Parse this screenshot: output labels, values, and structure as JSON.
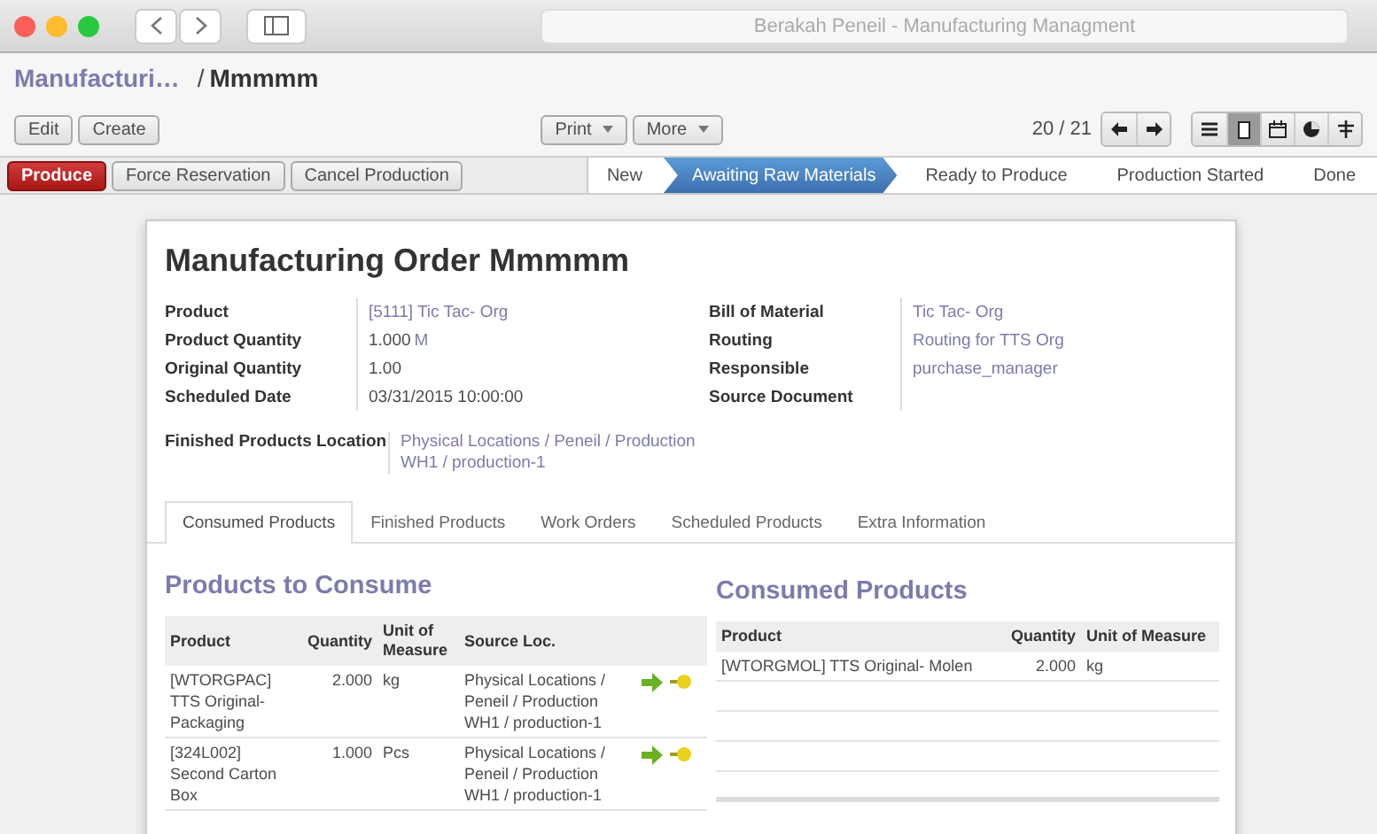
{
  "window": {
    "title": "Berakah Peneil - Manufacturing Managment"
  },
  "breadcrumb": {
    "parent": "Manufacturi…",
    "separator": "/",
    "current": "Mmmmm"
  },
  "toolbar": {
    "left_buttons": [
      "Edit",
      "Create"
    ],
    "menus": [
      "Print",
      "More"
    ],
    "pager": "20 / 21",
    "views": [
      {
        "kind": "list",
        "selected": false
      },
      {
        "kind": "form",
        "selected": true
      },
      {
        "kind": "calendar",
        "selected": false
      },
      {
        "kind": "graph",
        "selected": false
      },
      {
        "kind": "gantt",
        "selected": false
      }
    ]
  },
  "actions": [
    {
      "label": "Produce",
      "kind": "primary"
    },
    {
      "label": "Force Reservation",
      "kind": "default"
    },
    {
      "label": "Cancel Production",
      "kind": "default"
    }
  ],
  "stages": [
    {
      "label": "New",
      "selected": false
    },
    {
      "label": "Awaiting Raw Materials",
      "selected": true
    },
    {
      "label": "Ready to Produce",
      "selected": false
    },
    {
      "label": "Production Started",
      "selected": false
    },
    {
      "label": "Done",
      "selected": false
    }
  ],
  "form": {
    "title": "Manufacturing Order Mmmmm",
    "left_fields": [
      {
        "label": "Product",
        "value": "[5111] Tic Tac- Org",
        "kind": "link"
      },
      {
        "label": "Product Quantity",
        "value": "1.000",
        "unit": "M",
        "kind": "quantity"
      },
      {
        "label": "Original Quantity",
        "value": "1.00",
        "kind": "text"
      },
      {
        "label": "Scheduled Date",
        "value": "03/31/2015 10:00:00",
        "kind": "text"
      }
    ],
    "right_fields": [
      {
        "label": "Bill of Material",
        "value": "Tic Tac- Org",
        "kind": "link"
      },
      {
        "label": "Routing",
        "value": "Routing for TTS Org",
        "kind": "link"
      },
      {
        "label": "Responsible",
        "value": "purchase_manager",
        "kind": "link"
      },
      {
        "label": "Source Document",
        "kind": "text"
      }
    ],
    "location": {
      "label": "Finished Products Location",
      "lines": [
        "Physical Locations / Peneil / Production",
        "WH1 / production-1"
      ]
    }
  },
  "tabs": [
    {
      "label": "Consumed Products",
      "selected": true
    },
    {
      "label": "Finished Products",
      "selected": false
    },
    {
      "label": "Work Orders",
      "selected": false
    },
    {
      "label": "Scheduled Products",
      "selected": false
    },
    {
      "label": "Extra Information",
      "selected": false
    }
  ],
  "to_consume": {
    "title": "Products to Consume",
    "columns": [
      "Product",
      "Quantity",
      "Unit of Measure",
      "Source Loc."
    ],
    "rows": [
      {
        "product": "[WTORGPAC] TTS Original-Packaging",
        "quantity": "2.000",
        "unit": "kg",
        "source": "Physical Locations / Peneil / Production WH1 / production-1"
      },
      {
        "product": "[324L002] Second Carton Box",
        "quantity": "1.000",
        "unit": "Pcs",
        "source": "Physical Locations / Peneil / Production WH1 / production-1"
      }
    ]
  },
  "consumed": {
    "title": "Consumed Products",
    "columns": [
      "Product",
      "Quantity",
      "Unit of Measure"
    ],
    "rows": [
      {
        "product": "[WTORGMOL] TTS Original- Molen",
        "quantity": "2.000",
        "unit": "kg"
      }
    ]
  }
}
